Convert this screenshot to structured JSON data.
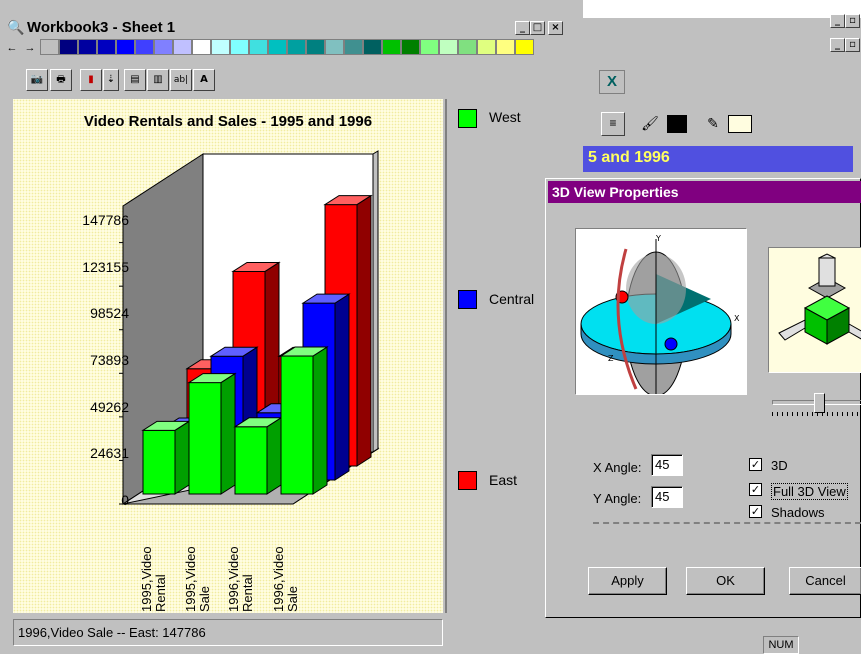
{
  "workbook": {
    "title": "Workbook3 - Sheet 1",
    "palette": [
      "#c0c0c0",
      "#000080",
      "#0000a0",
      "#0000c0",
      "#0000ff",
      "#4040ff",
      "#8080ff",
      "#c0c0ff",
      "#ffffff",
      "#c0ffff",
      "#80ffff",
      "#40e0e0",
      "#00c0c0",
      "#00a0a0",
      "#008080",
      "#80c0c0",
      "#409090",
      "#006060",
      "#00c000",
      "#008000",
      "#80ff80",
      "#c0ffc0",
      "#80e080",
      "#e0ff80",
      "#ffff80",
      "#ffff00"
    ],
    "status_text": "1996,Video Sale -- East: 147786"
  },
  "chart_data": {
    "type": "bar",
    "title": "Video Rentals and Sales - 1995 and 1996",
    "categories": [
      "1995,Video Rental",
      "1995,Video Sale",
      "1996,Video Rental",
      "1996,Video Sale"
    ],
    "series": [
      {
        "name": "West",
        "color": "#00ff00",
        "values": [
          36000,
          63000,
          38000,
          78000
        ]
      },
      {
        "name": "Central",
        "color": "#0000ff",
        "values": [
          30000,
          70000,
          38000,
          100000
        ]
      },
      {
        "name": "East",
        "color": "#ff0000",
        "values": [
          55000,
          110000,
          62000,
          147786
        ]
      }
    ],
    "yticks": [
      "147786",
      "123155",
      "98524",
      "73893",
      "49262",
      "24631",
      "0"
    ],
    "ylim": [
      0,
      160000
    ],
    "legend": "right"
  },
  "background_app": {
    "title_fragment": "5 and 1996",
    "status_num": "NUM"
  },
  "dialog": {
    "title": "3D View Properties",
    "x_angle_label": "X Angle:",
    "x_angle_value": "45",
    "y_angle_label": "Y Angle:",
    "y_angle_value": "45",
    "check_3d": "3D",
    "check_full": "Full 3D View",
    "check_shadows": "Shadows",
    "apply": "Apply",
    "ok": "OK",
    "cancel": "Cancel"
  }
}
